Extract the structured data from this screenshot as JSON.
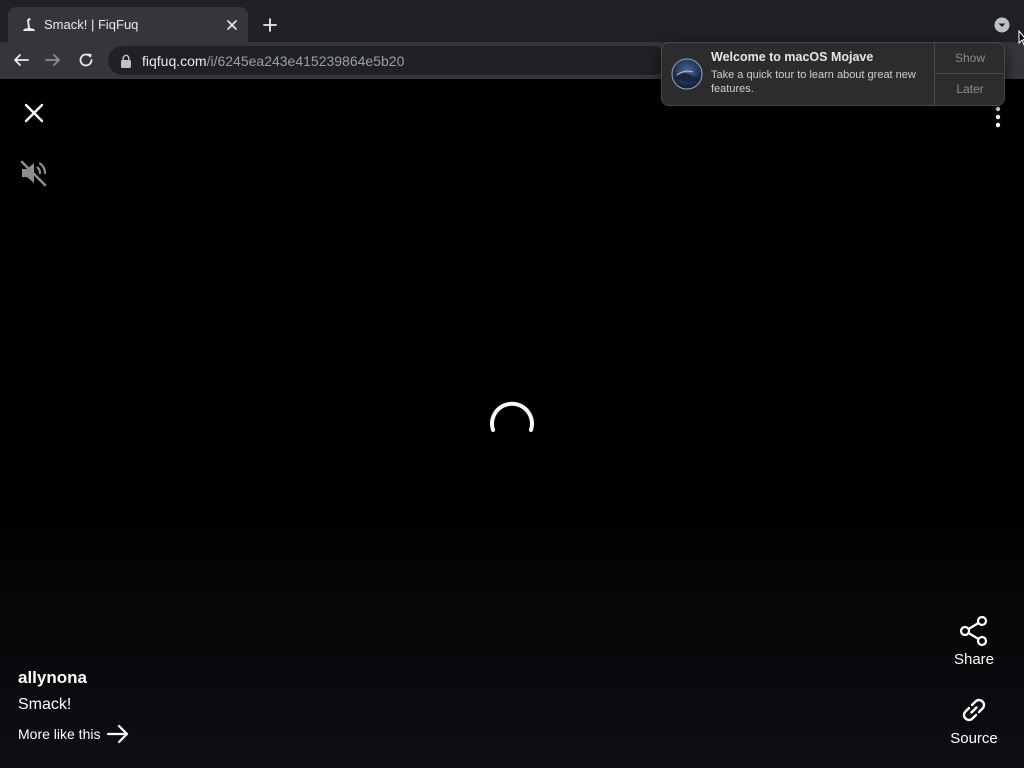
{
  "browser": {
    "tab": {
      "title": "Smack! | FiqFuq"
    },
    "url": {
      "host": "fiqfuq.com",
      "path": "/i/6245ea243e415239864e5b20"
    }
  },
  "post": {
    "author": "allynona",
    "description": "Smack!",
    "more_link": "More like this"
  },
  "actions": {
    "share_label": "Share",
    "source_label": "Source"
  },
  "notification": {
    "title": "Welcome to macOS Mojave",
    "body": "Take a quick tour to learn about great new features.",
    "show_label": "Show",
    "later_label": "Later"
  },
  "colors": {
    "page_background": "#000000",
    "chrome_dark": "#202124",
    "chrome_toolbar": "#35363a"
  }
}
